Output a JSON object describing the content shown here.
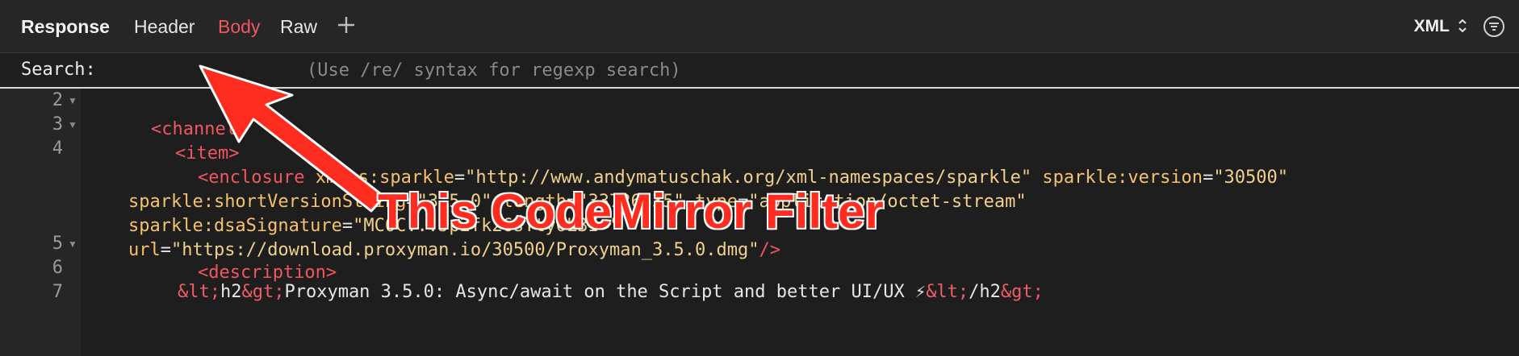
{
  "toolbar": {
    "title": "Response",
    "tabs": [
      {
        "label": "Header"
      },
      {
        "label": "Body"
      },
      {
        "label": "Raw"
      }
    ],
    "active_tab": "Body",
    "format": "XML",
    "accent_color": "#f0565f"
  },
  "search": {
    "label": "Search:",
    "value": "",
    "placeholder": "(Use /re/ syntax for regexp search)"
  },
  "editor": {
    "lines": [
      {
        "number": "2",
        "folded": true
      },
      {
        "number": "3",
        "folded": true
      },
      {
        "number": "4",
        "folded": false
      },
      {
        "number": "5",
        "folded": true
      },
      {
        "number": "6",
        "folded": false
      },
      {
        "number": "7",
        "folded": false
      }
    ],
    "code": {
      "l2": "<channel>",
      "l3": "<item>",
      "l4_tag": "<enclosure",
      "l4_attr1": "xmlns:sparkle",
      "l4_val1": "\"http://www.andymatuschak.org/xml-namespaces/sparkle\"",
      "l4_attr2": "sparkle:version",
      "l4_val2": "\"30500\"",
      "l4b_attr1": "sparkle:shortVersionString",
      "l4b_val1": "\"3.5.0\"",
      "l4b_attr2": "length",
      "l4b_val2": "\"33726535\"",
      "l4b_attr3": "type",
      "l4b_val3": "\"application/octet-stream\"",
      "l4c_attr": "sparkle:dsaSignature",
      "l4c_val": "\"MC0C...Jp2fk26sTty0L3I=\"",
      "l4d_attr": "url",
      "l4d_val": "\"https://download.proxyman.io/30500/Proxyman_3.5.0.dmg\"",
      "l4d_end": "/>",
      "l5": "<description>",
      "l7_ent1": "&lt;",
      "l7_text1": "h2",
      "l7_ent2": "&gt;",
      "l7_text2": "Proxyman 3.5.0: Async/await on the Script and better UI/UX ⚡",
      "l7_ent3": "&lt;",
      "l7_text3": "/h2",
      "l7_ent4": "&gt;"
    }
  },
  "annotation": {
    "text": "This CodeMirror Filter",
    "color": "#ff2d1f"
  }
}
